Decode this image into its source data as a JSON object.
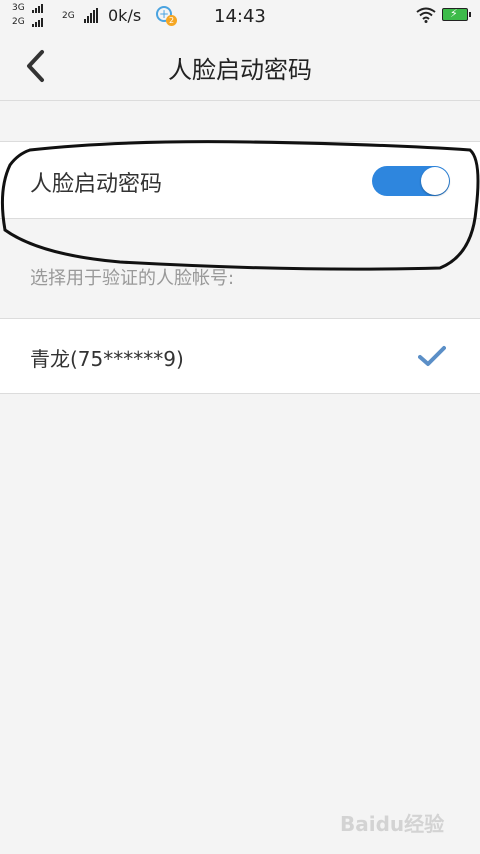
{
  "status_bar": {
    "net1": "3G",
    "net2": "2G",
    "net3": "2G",
    "speed": "0k/s",
    "sync_badge": "2",
    "time": "14:43"
  },
  "header": {
    "title": "人脸启动密码"
  },
  "toggle": {
    "label": "人脸启动密码",
    "state": "on",
    "color": "#2e86de"
  },
  "hint": "选择用于验证的人脸帐号:",
  "accounts": [
    {
      "label": "青龙(75******9)",
      "selected": true
    }
  ],
  "watermark": "Baidu经验"
}
